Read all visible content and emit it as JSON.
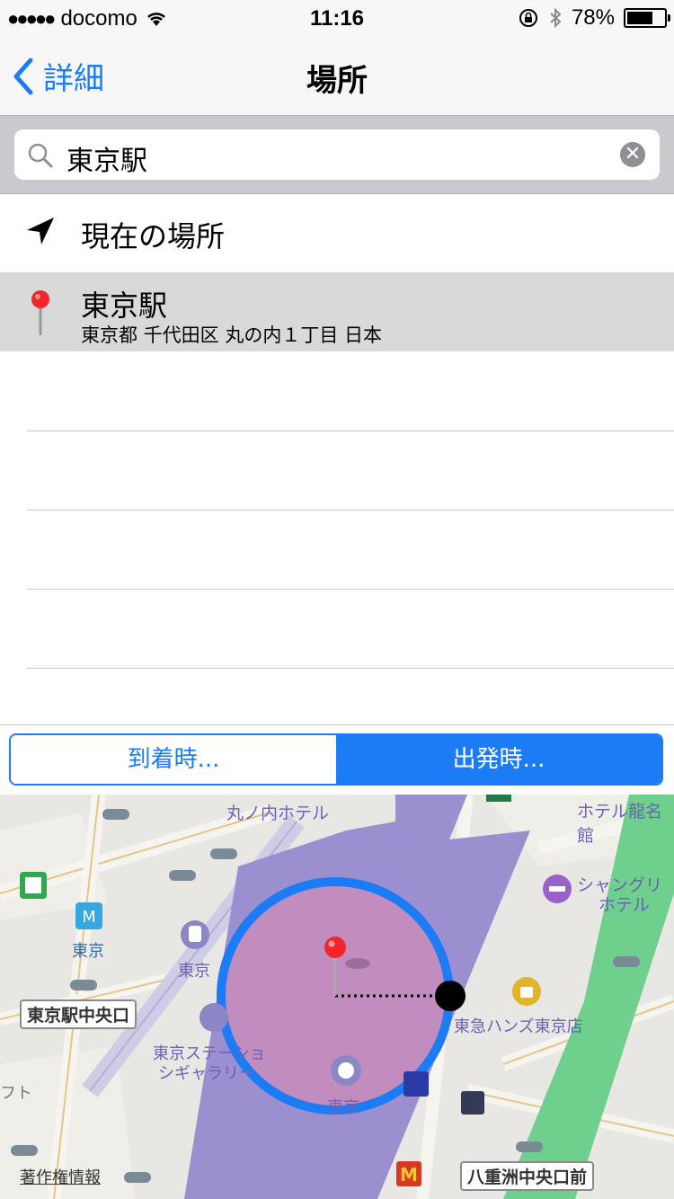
{
  "status_bar": {
    "signal_dots": "●●●●●",
    "carrier": "docomo",
    "time": "11:16",
    "battery_percent": "78%",
    "battery_level": 0.78
  },
  "nav": {
    "back_label": "詳細",
    "title": "場所"
  },
  "search": {
    "value": "東京駅",
    "clear_symbol": "✕"
  },
  "results": {
    "current_location_label": "現在の場所",
    "selected_title": "東京駅",
    "selected_address": "東京都 千代田区 丸の内１丁目 日本"
  },
  "segment": {
    "arrival_label": "到着時...",
    "departure_label": "出発時...",
    "selected": "departure"
  },
  "map": {
    "labels": {
      "marunouchi_hotel": "丸ノ内ホテル",
      "hotel_ryumeikan": "ホテル龍名館",
      "shangri_la_1": "シャングリ",
      "shangri_la_2": "ホテル",
      "tokyo_metro": "東京",
      "tokyo_jr": "東京",
      "central_exit": "東京駅中央口",
      "tokyu_hands": "東急ハンズ東京店",
      "gallery_1": "東京ステーショ",
      "gallery_2": "シギャラリー",
      "station": "東京",
      "yaesu_exit": "八重洲中央口前",
      "left_fragment": "フト",
      "copyright": "著作権情報"
    },
    "colors": {
      "geofence": "#1b7cf5",
      "station_fill": "#9b8fd0",
      "park": "#6fcf8d"
    }
  },
  "icons": {
    "back": "chevron-left-icon",
    "search": "magnifier-icon",
    "clear": "clear-icon",
    "location": "location-arrow-icon",
    "pin": "red-pin-icon"
  }
}
